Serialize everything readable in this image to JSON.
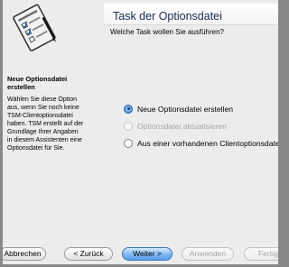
{
  "header": {
    "title": "Task der Optionsdatei",
    "question": "Welche Task wollen Sie ausführen?"
  },
  "sidebar": {
    "step_title_line1": "Neue Optionsdatei",
    "step_title_line2": "erstellen",
    "description_lines": [
      "Wählen Sie diese Option",
      "aus, wenn Sie noch keine",
      "TSM-Clientoptionsdatei",
      "haben. TSM erstellt auf der",
      "Grundlage Ihrer Angaben",
      "in diesem Assistenten eine",
      "Optionsdatei für Sie."
    ]
  },
  "options": [
    {
      "label": "Neue Optionsdatei erstellen",
      "selected": true,
      "enabled": true
    },
    {
      "label": "Optionsdatei aktualisieren",
      "selected": false,
      "enabled": false
    },
    {
      "label": "Aus einer vorhandenen Clientoptionsdatei importieren",
      "selected": false,
      "enabled": true
    }
  ],
  "buttons": {
    "cancel": "Abbrechen",
    "back": "< Zurück",
    "next": "Weiter >",
    "apply": "Anwenden",
    "finish": "Fertig"
  },
  "colors": {
    "accent": "#5a9ee9",
    "title_text": "#1d2a52",
    "disabled_text": "#a6a6a6",
    "window_bg": "#ececec"
  },
  "icons": {
    "wizard_art": "document-checklist-with-pen"
  }
}
